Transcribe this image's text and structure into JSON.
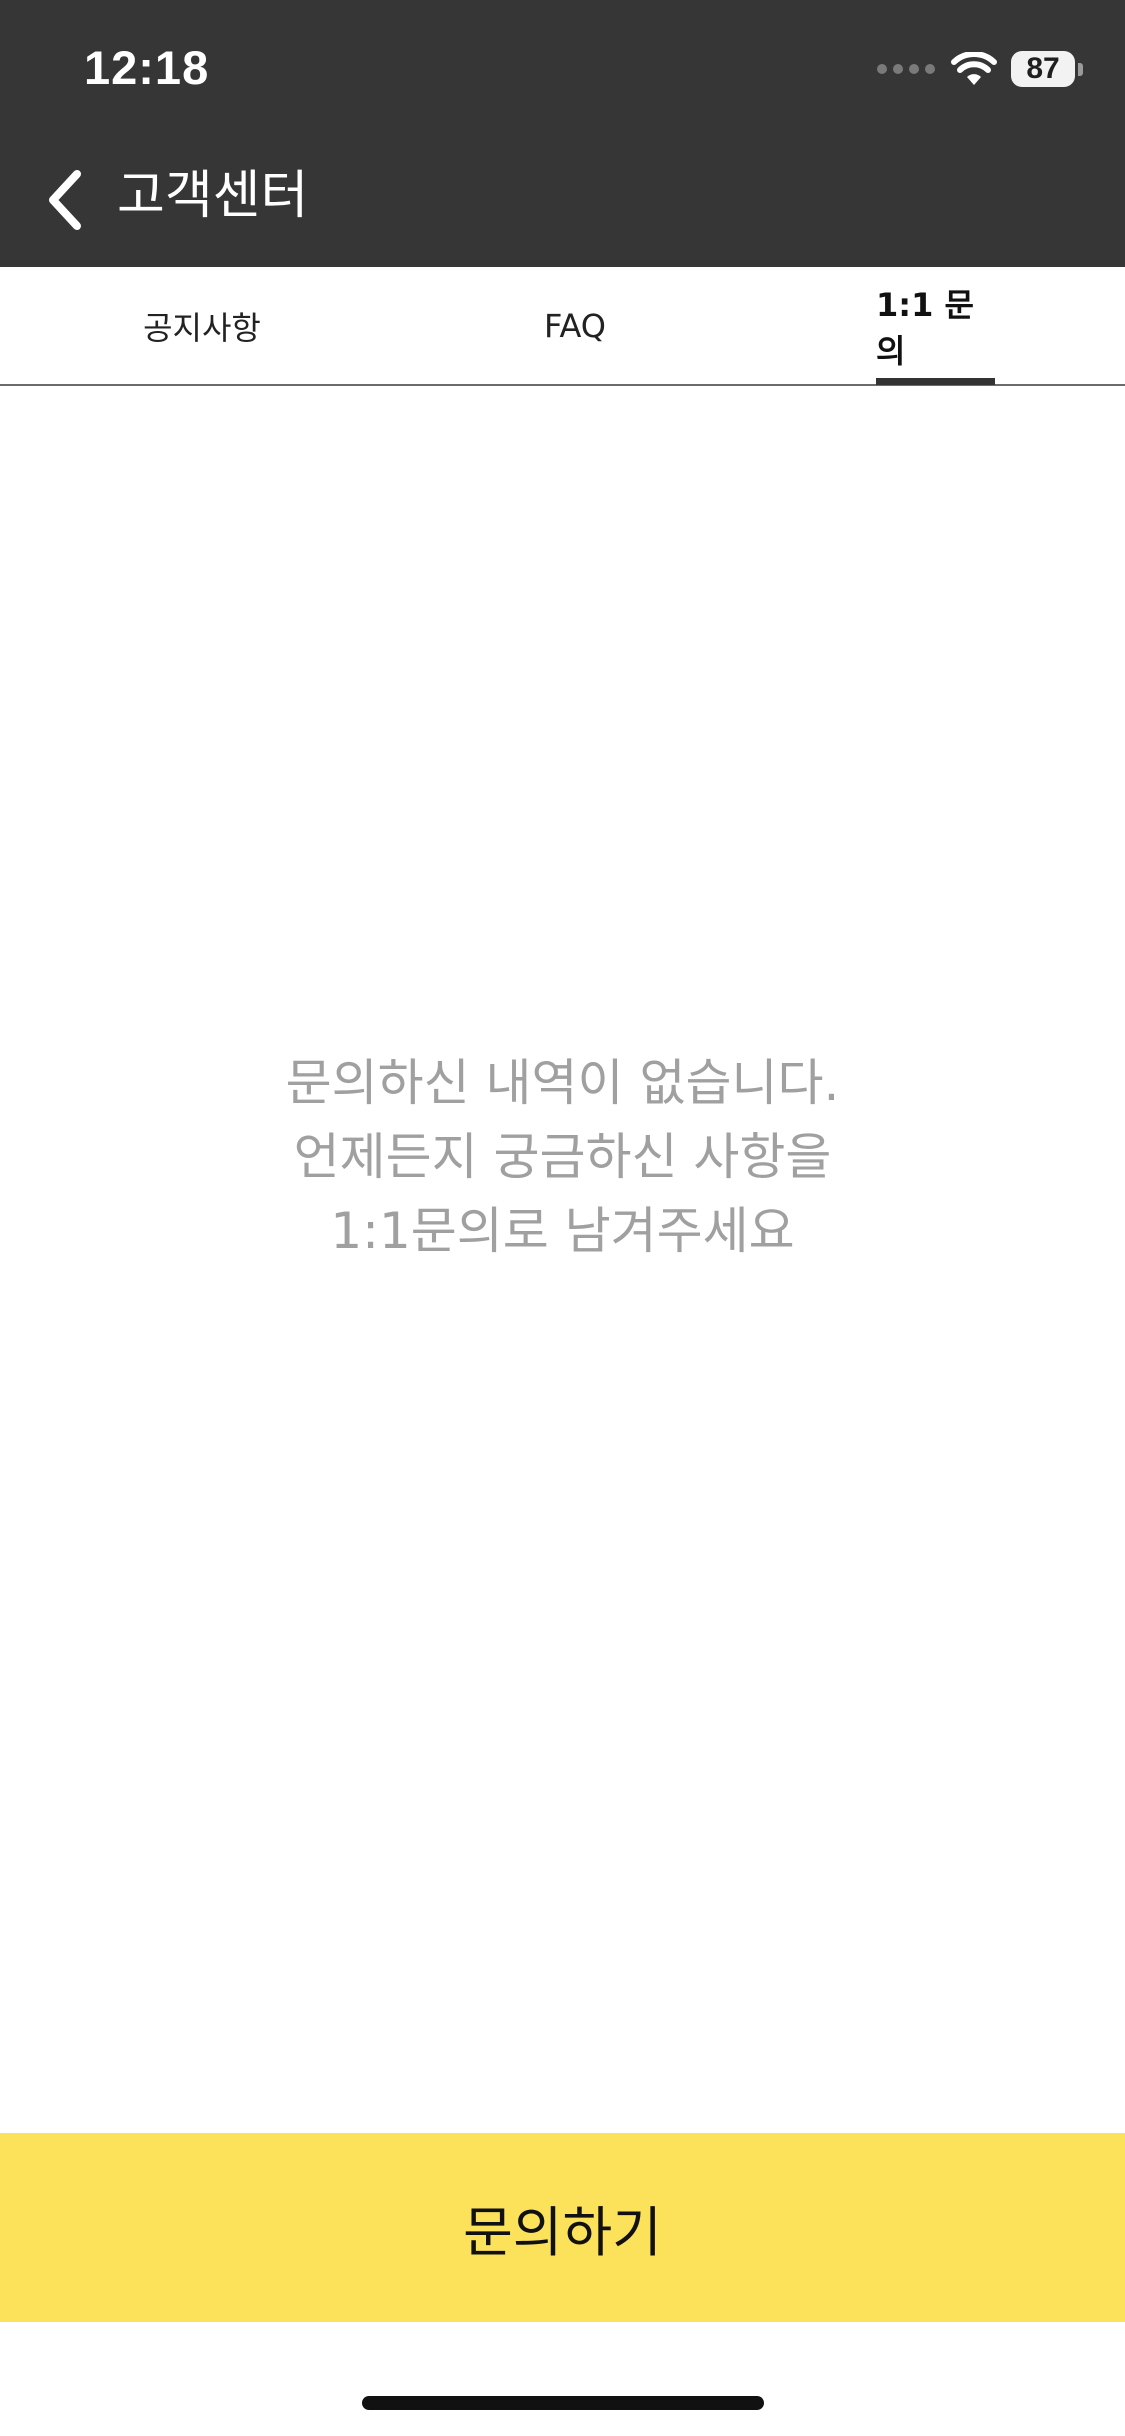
{
  "status_bar": {
    "time": "12:18",
    "battery": "87",
    "icons": [
      "cellular-signal-icon",
      "wifi-icon",
      "battery-icon"
    ]
  },
  "header": {
    "title": "고객센터",
    "back_icon": "chevron-left-icon",
    "background": "#363636"
  },
  "tabs": [
    {
      "label": "공지사항",
      "active": false
    },
    {
      "label": "FAQ",
      "active": false
    },
    {
      "label": "1:1 문의",
      "active": true
    }
  ],
  "empty_state": {
    "lines": [
      "문의하신 내역이 없습니다.",
      "언제든지 궁금하신 사항을",
      "1:1문의로 남겨주세요"
    ]
  },
  "footer": {
    "inquiry_button_label": "문의하기",
    "button_color": "#fce15b"
  }
}
